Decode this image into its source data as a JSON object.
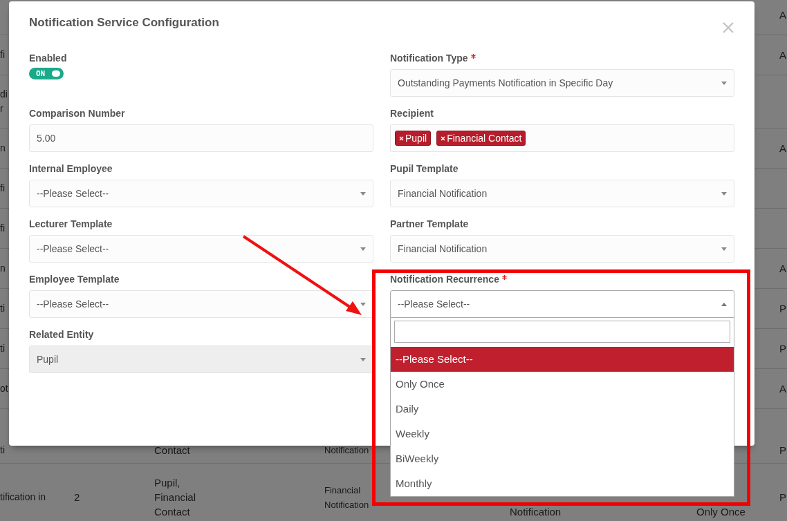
{
  "background_table": {
    "rows": [
      {
        "column_7": [
          "A"
        ]
      },
      {
        "column_1": [
          "fi"
        ],
        "column_7": [
          "A"
        ]
      },
      {
        "column_1": [
          "di",
          "r"
        ]
      },
      {
        "column_1": [
          "n"
        ],
        "column_7": [
          "A"
        ]
      },
      {
        "column_1": [
          "fi"
        ]
      },
      {
        "column_1": [
          "fi"
        ]
      },
      {
        "column_1": [
          "n"
        ],
        "column_7": [
          "A"
        ]
      },
      {
        "column_1": [
          "ti"
        ],
        "column_7": [
          "P"
        ]
      },
      {
        "column_1": [
          "ti"
        ],
        "column_7": [
          "P"
        ]
      },
      {
        "column_1": [
          "ot"
        ],
        "column_7": [
          "A"
        ]
      },
      {
        "column_1": [
          "ti"
        ],
        "column_3": [
          "Contact"
        ],
        "column_4": [
          "Notification"
        ],
        "column_7": [
          "P"
        ]
      },
      {
        "column_1": [
          "tification in"
        ],
        "column_2": [
          "2"
        ],
        "column_3": [
          "Pupil,",
          "Financial",
          "Contact"
        ],
        "column_4": [
          "Financial",
          "Notification"
        ],
        "column_5": [
          "Notification"
        ],
        "column_6": [
          "Only Once"
        ],
        "column_7": [
          "P"
        ]
      }
    ]
  },
  "dialog": {
    "title": "Notification Service Configuration",
    "fields": [
      {
        "kind": "toggle",
        "label": "Enabled",
        "required": false,
        "on": true,
        "text": "ON"
      },
      {
        "kind": "select",
        "label": "Notification Type",
        "required": true,
        "disabled": false,
        "expanded": false,
        "value": "Outstanding Payments Notification in Specific Day"
      },
      {
        "kind": "input",
        "label": "Comparison Number",
        "required": false,
        "value": "5.00"
      },
      {
        "kind": "tags",
        "label": "Recipient",
        "required": false,
        "tags": [
          "Pupil",
          "Financial Contact"
        ]
      },
      {
        "kind": "select",
        "label": "Internal Employee",
        "required": false,
        "disabled": false,
        "expanded": false,
        "value": "--Please Select--"
      },
      {
        "kind": "select",
        "label": "Pupil Template",
        "required": false,
        "disabled": false,
        "expanded": false,
        "value": "Financial Notification"
      },
      {
        "kind": "select",
        "label": "Lecturer Template",
        "required": false,
        "disabled": false,
        "expanded": false,
        "value": "--Please Select--"
      },
      {
        "kind": "select",
        "label": "Partner Template",
        "required": false,
        "disabled": false,
        "expanded": false,
        "value": "Financial Notification"
      },
      {
        "kind": "select",
        "label": "Employee Template",
        "required": false,
        "disabled": false,
        "expanded": false,
        "value": "--Please Select--"
      },
      {
        "kind": "select",
        "label": "Notification Recurrence",
        "required": true,
        "disabled": false,
        "expanded": true,
        "value": "--Please Select--",
        "options": [
          {
            "label": "--Please Select--",
            "selected": true
          },
          {
            "label": "Only Once",
            "selected": false
          },
          {
            "label": "Daily",
            "selected": false
          },
          {
            "label": "Weekly",
            "selected": false
          },
          {
            "label": "BiWeekly",
            "selected": false
          },
          {
            "label": "Monthly",
            "selected": false
          }
        ]
      },
      {
        "kind": "select",
        "label": "Related Entity",
        "required": false,
        "disabled": true,
        "expanded": false,
        "value": "Pupil"
      }
    ]
  }
}
